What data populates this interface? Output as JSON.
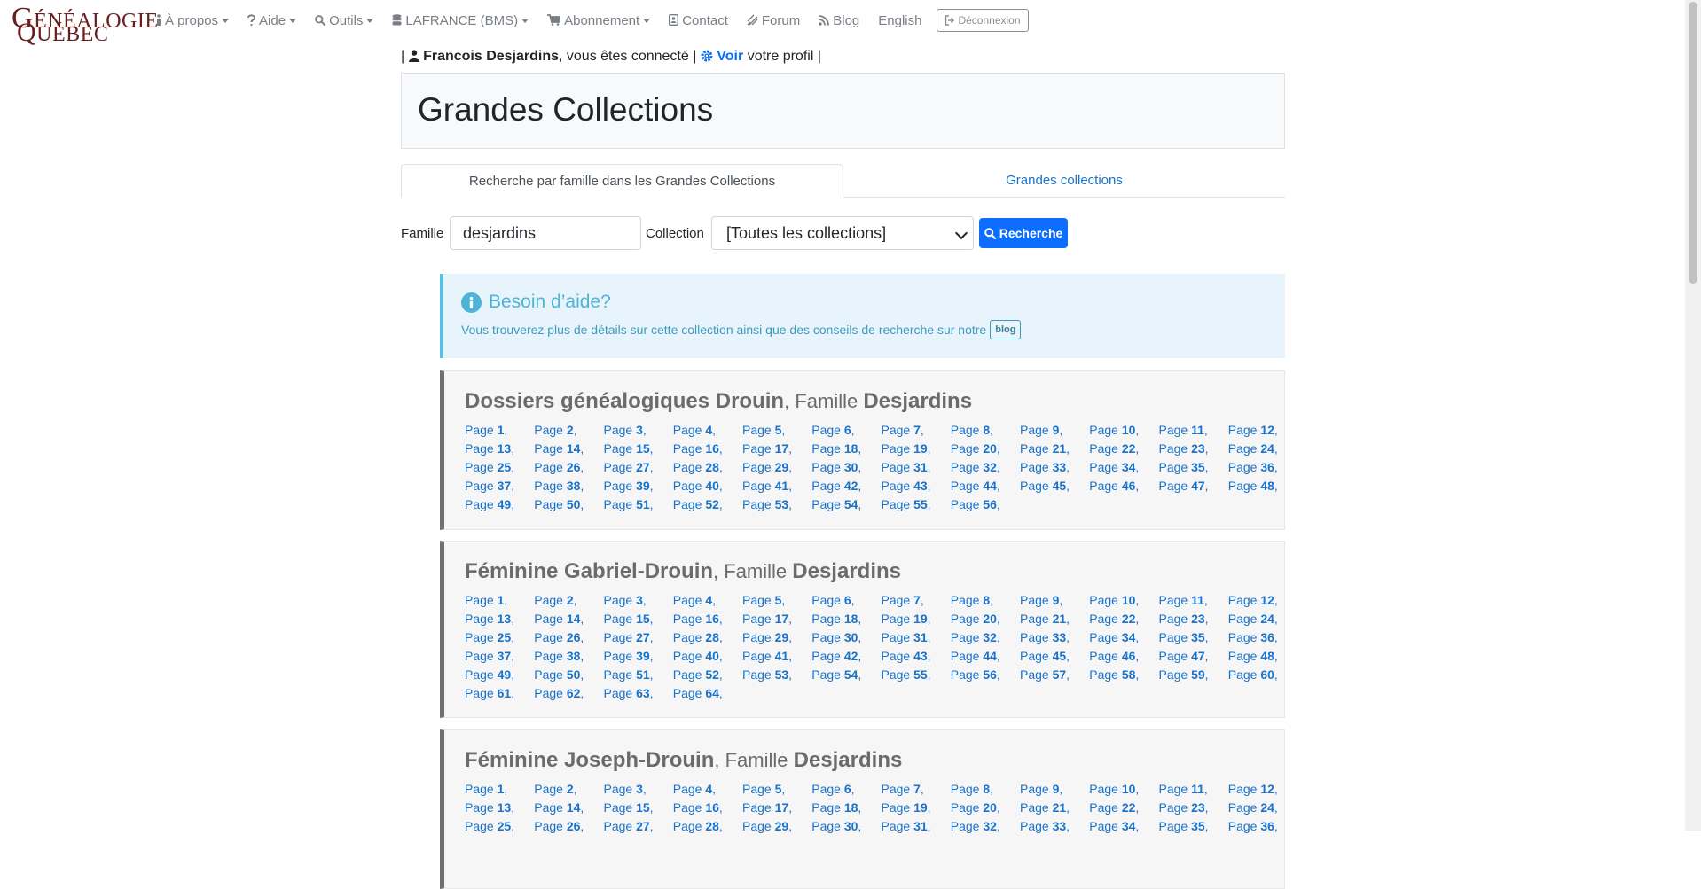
{
  "logo": {
    "line1": "GÉNÉALOGIE",
    "line2": "QUÉBEC"
  },
  "nav": [
    {
      "label": "À propos",
      "icon": "info-icon",
      "caret": true
    },
    {
      "label": "Aide",
      "icon": "question-icon",
      "caret": true
    },
    {
      "label": "Outils",
      "icon": "search-icon",
      "caret": true
    },
    {
      "label": "LAFRANCE (BMS)",
      "icon": "database-icon",
      "caret": true
    },
    {
      "label": "Abonnement",
      "icon": "cart-icon",
      "caret": true
    },
    {
      "label": "Contact",
      "icon": "contact-icon",
      "caret": false
    },
    {
      "label": "Forum",
      "icon": "forum-icon",
      "caret": false
    },
    {
      "label": "Blog",
      "icon": "rss-icon",
      "caret": false
    },
    {
      "label": "English",
      "icon": "",
      "caret": false
    }
  ],
  "logout_label": "Déconnexion",
  "user": {
    "sep1": "|",
    "name": "Francois Desjardins",
    "connected": ", vous êtes connecté",
    "sep2": "|",
    "voir": "Voir",
    "profile": "votre profil",
    "sep3": "|"
  },
  "page_title": "Grandes Collections",
  "tabs": {
    "active": "Recherche par famille dans les Grandes Collections",
    "other": "Grandes collections"
  },
  "search": {
    "famille_label": "Famille",
    "famille_value": "desjardins",
    "collection_label": "Collection",
    "collection_value": "[Toutes les collections]",
    "button_label": "Recherche"
  },
  "help": {
    "title": "Besoin d’aide?",
    "text": "Vous trouverez plus de détails sur cette collection ainsi que des conseils de recherche sur notre",
    "blog_button": "blog"
  },
  "page_word": "Page",
  "collections": [
    {
      "name": "Dossiers généalogiques Drouin",
      "famille_word": ", Famille ",
      "family": "Desjardins",
      "page_count": 56
    },
    {
      "name": "Féminine Gabriel-Drouin",
      "famille_word": ", Famille ",
      "family": "Desjardins",
      "page_count": 64
    },
    {
      "name": "Féminine Joseph-Drouin",
      "famille_word": ", Famille ",
      "family": "Desjardins",
      "page_count": 36
    }
  ],
  "colors": {
    "link": "#1a73c9",
    "primary": "#0d6efd",
    "logo": "#6b1e1e",
    "info": "#5bc0de"
  }
}
